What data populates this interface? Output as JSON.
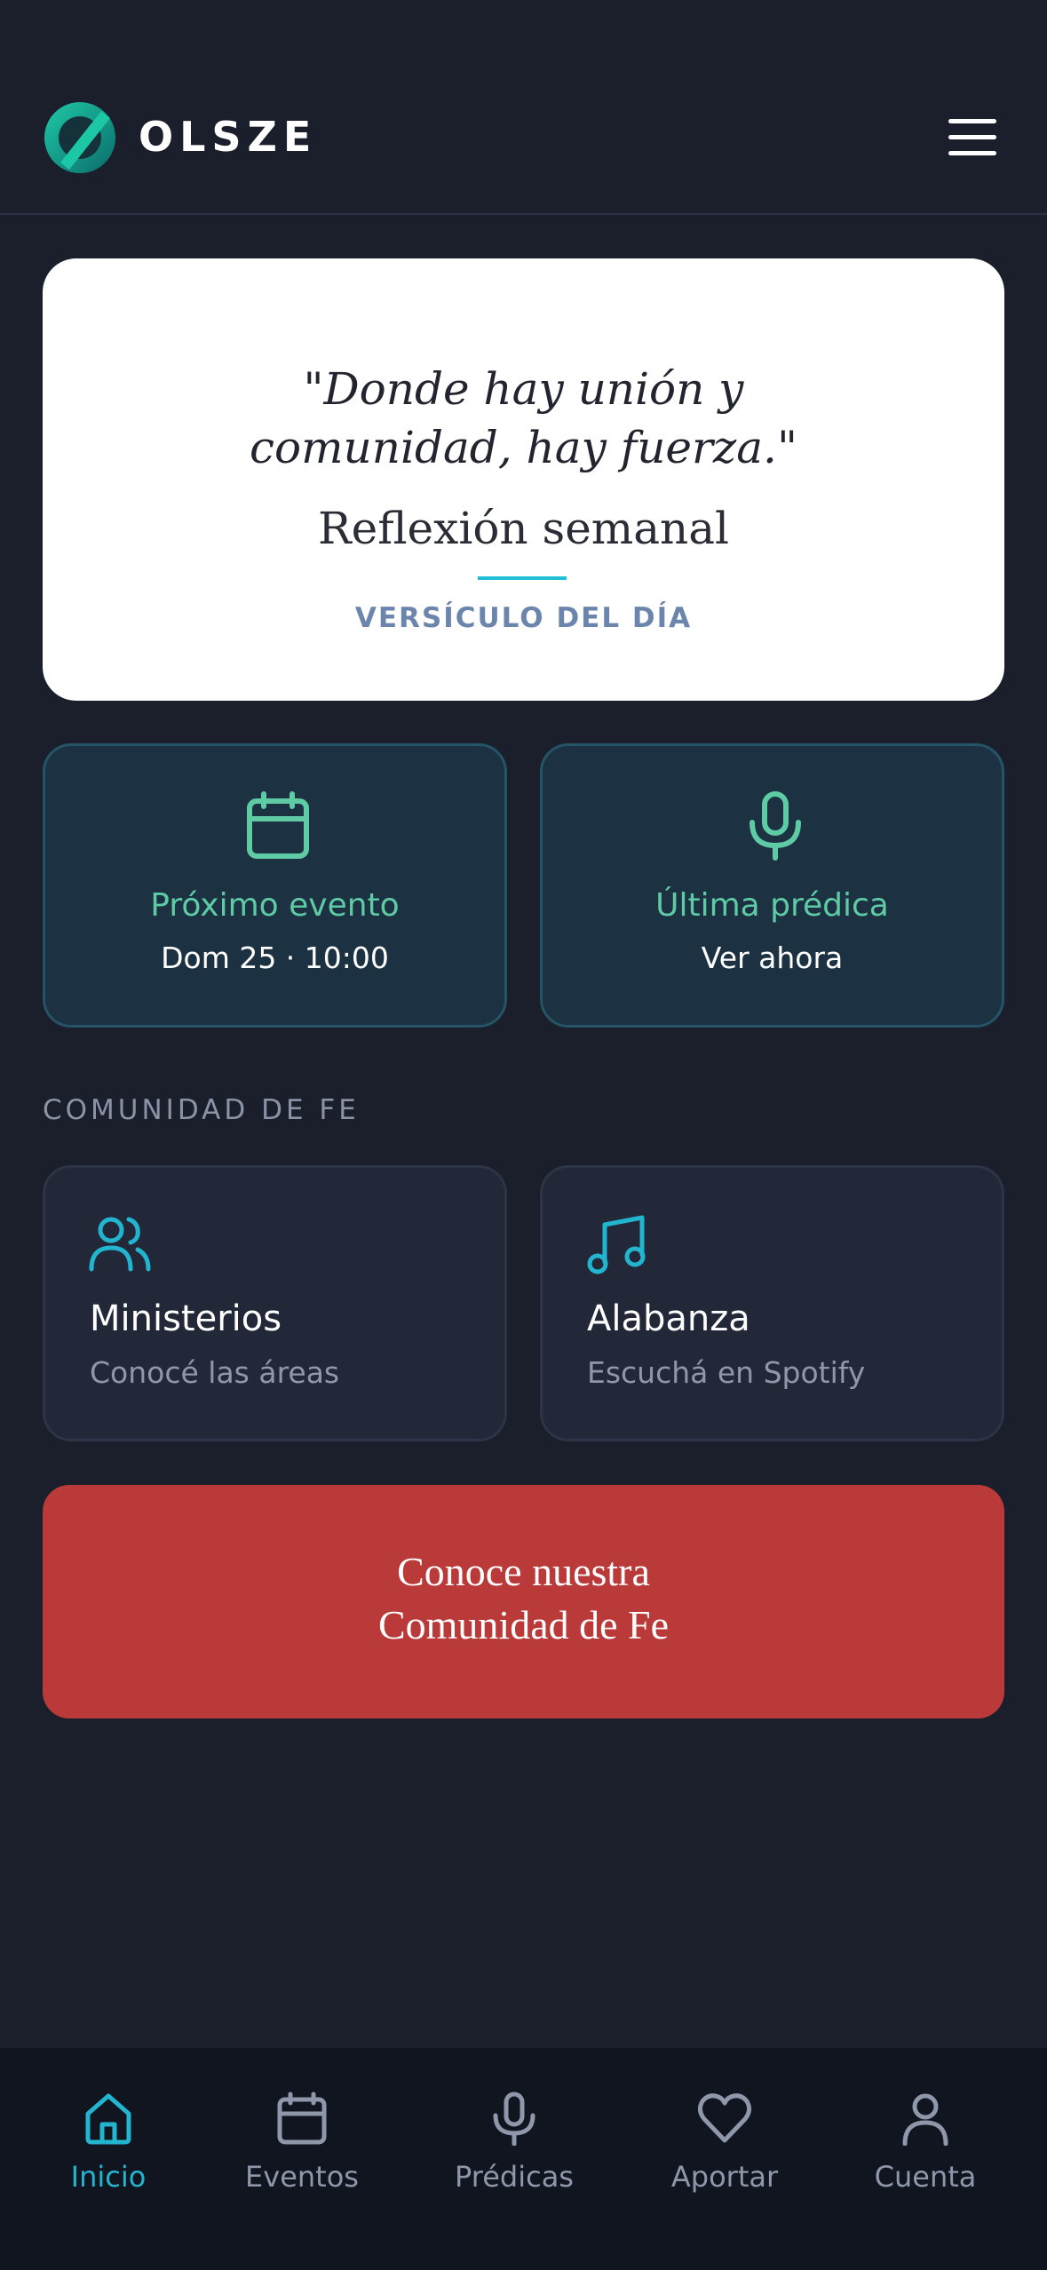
{
  "header": {
    "brand": "OLSZE",
    "logo_icon": "olsze-logo",
    "menu_icon": "hamburger-menu-icon"
  },
  "verse": {
    "quote_open": "\"",
    "quote_line1": "Donde hay unión y",
    "quote_line2": "comunidad, hay fuerza.",
    "quote_close": "\"",
    "reference": "Reflexión semanal",
    "label": "VERSÍCULO DEL DÍA",
    "accent_color": "#22c0d8"
  },
  "quick_cards": [
    {
      "icon": "calendar-icon",
      "title": "Próximo evento",
      "subtitle": "Dom 25 · 10:00"
    },
    {
      "icon": "microphone-icon",
      "title": "Última prédica",
      "subtitle": "Ver ahora"
    }
  ],
  "section": {
    "label": "COMUNIDAD DE FE"
  },
  "features": [
    {
      "icon": "users-icon",
      "title": "Ministerios",
      "subtitle": "Conocé las áreas"
    },
    {
      "icon": "music-note-icon",
      "title": "Alabanza",
      "subtitle": "Escuchá en Spotify"
    }
  ],
  "cta": {
    "line1": "Conoce nuestra",
    "line2": "Comunidad de Fe",
    "color": "#ba3a3a"
  },
  "tabbar": {
    "active": "Inicio",
    "active_color": "#22b5d0",
    "items": [
      {
        "icon": "home-icon",
        "label": "Inicio"
      },
      {
        "icon": "calendar-icon",
        "label": "Eventos"
      },
      {
        "icon": "microphone-icon",
        "label": "Prédicas"
      },
      {
        "icon": "heart-icon",
        "label": "Aportar"
      },
      {
        "icon": "user-icon",
        "label": "Cuenta"
      }
    ]
  }
}
